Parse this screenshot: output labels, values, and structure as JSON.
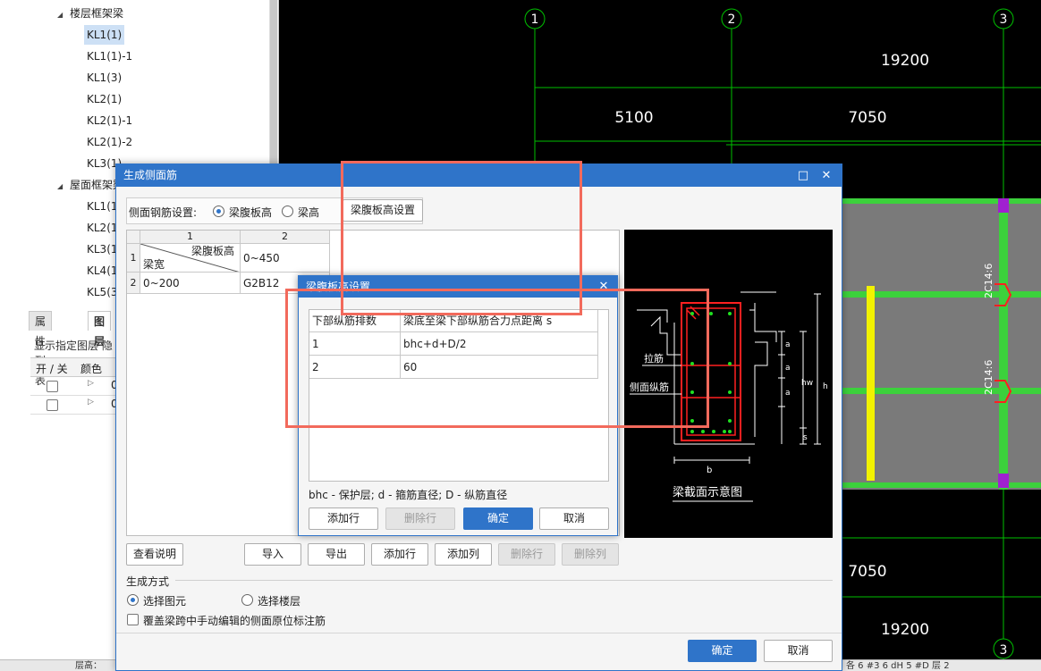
{
  "tree": {
    "group1": "楼层框架梁",
    "group1_items": [
      "KL1(1)",
      "KL1(1)-1",
      "KL1(3)",
      "KL2(1)",
      "KL2(1)-1",
      "KL2(1)-2",
      "KL3(1)"
    ],
    "group2": "屋面框架梁",
    "group2_items": [
      "KL1(1",
      "KL2(1",
      "KL3(1",
      "KL4(1",
      "KL5(3"
    ]
  },
  "props": {
    "tabs": [
      "属性列表",
      "图层"
    ],
    "toolbar_text": "显示指定图层  隐",
    "col_onoff": "开 / 关",
    "col_color": "颜色",
    "row1_letter": "0",
    "row2_letter": "0"
  },
  "cad": {
    "axes": [
      "1",
      "2",
      "3"
    ],
    "dims": [
      "19200",
      "5100",
      "7050",
      "7050",
      "19200"
    ],
    "rebar_labels": [
      "2C14:6",
      "2C14:6"
    ]
  },
  "status": {
    "left": "层高：",
    "right": "各 6 #3 6 dH 5 #D 层 2"
  },
  "main_dialog": {
    "title": "生成侧面筋",
    "maximize": "□",
    "close": "✕",
    "setting_label": "侧面钢筋设置:",
    "radio_web": "梁腹板高",
    "radio_height": "梁高",
    "web_setting_button": "梁腹板高设置",
    "grid": {
      "col_numbers": [
        "1",
        "2"
      ],
      "row_numbers": [
        "1",
        "2"
      ],
      "diag_top": "梁腹板高",
      "diag_bottom": "梁宽",
      "header_value": "0~450",
      "row_label": "0~200",
      "row_value": "G2B12"
    },
    "preview_caption": "梁截面示意图",
    "preview_labels": {
      "tie": "拉筋",
      "side": "侧面纵筋",
      "a": "a",
      "hw": "hw",
      "h": "h",
      "s": "s",
      "b": "b"
    },
    "buttons": {
      "help": "查看说明",
      "import": "导入",
      "export": "导出",
      "add_row": "添加行",
      "add_col": "添加列",
      "del_row": "删除行",
      "del_col": "删除列"
    },
    "gen_mode_label": "生成方式",
    "radio_select_elem": "选择图元",
    "radio_select_floor": "选择楼层",
    "cover_label": "覆盖梁跨中手动编辑的侧面原位标注筋",
    "ok": "确定",
    "cancel": "取消"
  },
  "sub_dialog": {
    "title": "梁腹板高设置",
    "close": "✕",
    "col1": "下部纵筋排数",
    "col2": "梁底至梁下部纵筋合力点距离 s",
    "rows": [
      {
        "n": "1",
        "v": "bhc+d+D/2"
      },
      {
        "n": "2",
        "v": "60"
      }
    ],
    "note": "bhc - 保护层; d - 箍筋直径; D - 纵筋直径",
    "add_row": "添加行",
    "del_row": "删除行",
    "ok": "确定",
    "cancel": "取消"
  }
}
